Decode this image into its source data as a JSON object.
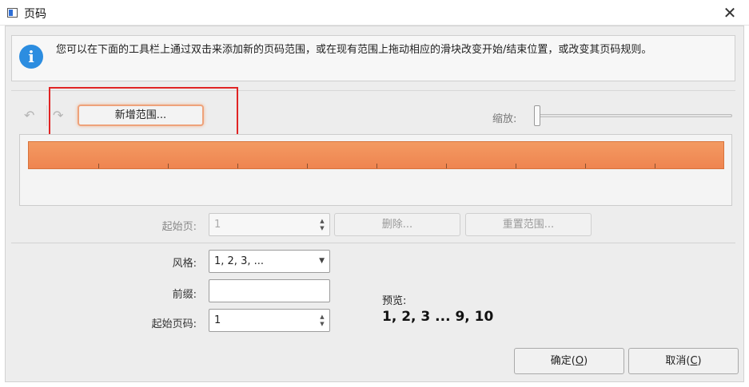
{
  "window": {
    "title": "页码",
    "close_glyph": "✕",
    "app_icon": "app-window-icon"
  },
  "info": {
    "icon": "info-icon",
    "icon_glyph": "i",
    "text": "您可以在下面的工具栏上通过双击来添加新的页码范围，或在现有范围上拖动相应的滑块改变开始/结束位置，或改变其页码规则。"
  },
  "toolbar": {
    "undo_glyph": "↶",
    "redo_glyph": "↷",
    "add_range_label": "新增范围...",
    "zoom_label": "缩放:",
    "zoom_value": 0
  },
  "range_editor": {
    "start_page_label": "起始页:",
    "start_page_value": "1",
    "delete_label": "删除...",
    "reset_label": "重置范围..."
  },
  "format": {
    "style_label": "风格:",
    "style_value": "1, 2, 3, ...",
    "prefix_label": "前缀:",
    "prefix_value": "",
    "start_number_label": "起始页码:",
    "start_number_value": "1",
    "preview_label": "预览:",
    "preview_value": "1, 2, 3 ... 9, 10"
  },
  "buttons": {
    "ok_text": "确定(",
    "ok_key": "O",
    "ok_end": ")",
    "cancel_text": "取消(",
    "cancel_key": "C",
    "cancel_end": ")"
  },
  "colors": {
    "range_bar": "#ef8450",
    "highlight": "#e02424",
    "info_icon": "#2c8de0"
  }
}
